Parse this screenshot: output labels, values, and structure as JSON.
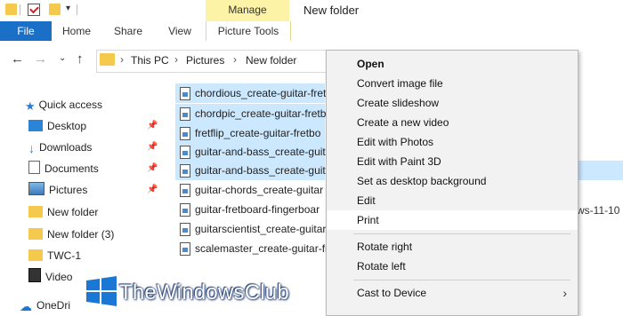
{
  "window": {
    "title": "New folder"
  },
  "ribbon": {
    "manage_label": "Manage",
    "tabs": [
      {
        "label": "File"
      },
      {
        "label": "Home"
      },
      {
        "label": "Share"
      },
      {
        "label": "View"
      },
      {
        "label": "Picture Tools"
      }
    ]
  },
  "address": {
    "breadcrumb": [
      "This PC",
      "Pictures",
      "New folder"
    ]
  },
  "nav_pane": {
    "items": [
      {
        "label": "Quick access",
        "icon": "star-icon",
        "pinned": false
      },
      {
        "label": "Desktop",
        "icon": "desktop-icon",
        "pinned": true
      },
      {
        "label": "Downloads",
        "icon": "downloads-icon",
        "pinned": true
      },
      {
        "label": "Documents",
        "icon": "documents-icon",
        "pinned": true
      },
      {
        "label": "Pictures",
        "icon": "pictures-icon",
        "pinned": true
      },
      {
        "label": "New folder",
        "icon": "folder-icon",
        "pinned": false
      },
      {
        "label": "New folder (3)",
        "icon": "folder-icon",
        "pinned": false
      },
      {
        "label": "TWC-1",
        "icon": "folder-icon",
        "pinned": false
      },
      {
        "label": "Video",
        "icon": "video-icon",
        "pinned": false
      },
      {
        "label": "OneDri",
        "icon": "cloud-icon",
        "pinned": false
      }
    ]
  },
  "files": [
    {
      "name": "chordious_create-guitar-fret",
      "selected": true
    },
    {
      "name": "chordpic_create-guitar-fretb",
      "selected": true
    },
    {
      "name": "fretflip_create-guitar-fretbo",
      "selected": true
    },
    {
      "name": "guitar-and-bass_create-guita",
      "selected": true
    },
    {
      "name": "guitar-and-bass_create-guit",
      "selected": true
    },
    {
      "name": "guitar-chords_create-guitar",
      "selected": false
    },
    {
      "name": "guitar-fretboard-fingerboar",
      "selected": false
    },
    {
      "name": "guitarscientist_create-guitar",
      "selected": false
    },
    {
      "name": "scalemaster_create-guitar-fr",
      "selected": false
    }
  ],
  "file_date_fragment": "ws-11-10",
  "context_menu": {
    "items": [
      {
        "label": "Open",
        "bold": true
      },
      {
        "label": "Convert image file"
      },
      {
        "label": "Create slideshow"
      },
      {
        "label": "Create a new video"
      },
      {
        "label": "Edit with Photos"
      },
      {
        "label": "Edit with Paint 3D"
      },
      {
        "label": "Set as desktop background"
      },
      {
        "label": "Edit"
      },
      {
        "label": "Print",
        "highlight": true
      },
      {
        "label": "Rotate right"
      },
      {
        "label": "Rotate left"
      },
      {
        "label": "Cast to Device",
        "submenu": true
      }
    ]
  },
  "watermark": {
    "text": "TheWindowsClub"
  },
  "colors": {
    "accent": "#1a6fc6",
    "selection": "#cce8ff",
    "manage_highlight": "#fcf3a6",
    "folder": "#f5c94e"
  }
}
